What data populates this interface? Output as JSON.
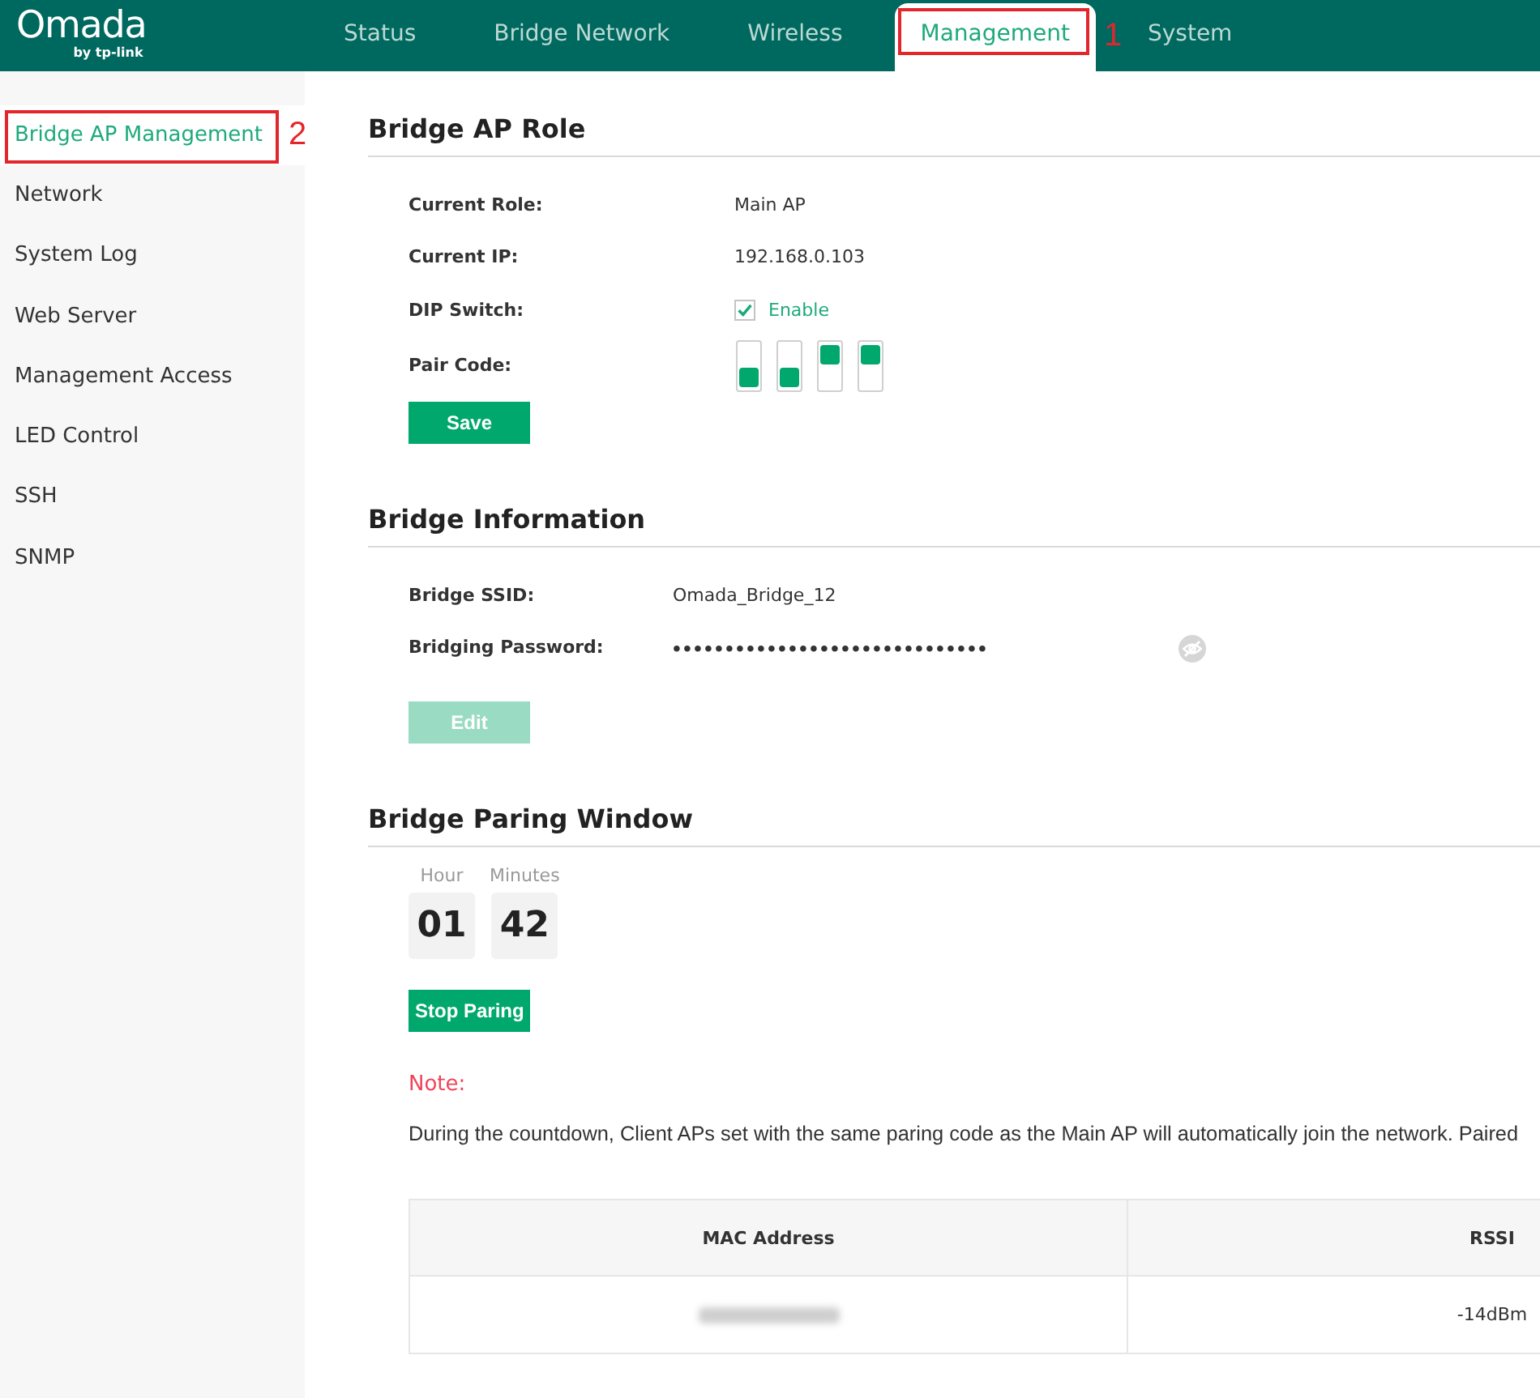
{
  "header": {
    "logo": {
      "wordmark": "Omada",
      "tagline": "by tp-link"
    },
    "tabs": [
      {
        "label": "Status",
        "selected": false
      },
      {
        "label": "Bridge Network",
        "selected": false
      },
      {
        "label": "Wireless",
        "selected": false
      },
      {
        "label": "Management",
        "selected": true,
        "callout": "1"
      },
      {
        "label": "System",
        "selected": false
      }
    ]
  },
  "sidebar": {
    "items": [
      {
        "label": "Bridge AP Management",
        "selected": true,
        "callout": "2"
      },
      {
        "label": "Network",
        "selected": false
      },
      {
        "label": "System Log",
        "selected": false
      },
      {
        "label": "Web Server",
        "selected": false
      },
      {
        "label": "Management Access",
        "selected": false
      },
      {
        "label": "LED Control",
        "selected": false
      },
      {
        "label": "SSH",
        "selected": false
      },
      {
        "label": "SNMP",
        "selected": false
      }
    ]
  },
  "sections": [
    {
      "kind": "role",
      "title": "Bridge AP Role",
      "fields": [
        {
          "kind": "text",
          "label": "Current Role:",
          "value": "Main AP"
        },
        {
          "kind": "text",
          "label": "Current IP:",
          "value": "192.168.0.103"
        },
        {
          "kind": "checkbox",
          "label": "DIP Switch:",
          "checked": true,
          "option": "Enable"
        },
        {
          "kind": "dip",
          "label": "Pair Code:",
          "switches": [
            {
              "on": false
            },
            {
              "on": false
            },
            {
              "on": true
            },
            {
              "on": true
            }
          ]
        }
      ],
      "button": {
        "label": "Save",
        "disabled": false
      }
    },
    {
      "kind": "info",
      "title": "Bridge Information",
      "fields": [
        {
          "kind": "text",
          "label": "Bridge SSID:",
          "value": "Omada_Bridge_12"
        },
        {
          "kind": "password",
          "label": "Bridging Password:",
          "value": "••••••••••••••••••••••••••••••"
        }
      ],
      "button": {
        "label": "Edit",
        "disabled": true
      }
    },
    {
      "kind": "pairing",
      "title": "Bridge Paring Window",
      "countdown": [
        {
          "label": "Hour",
          "value": "01"
        },
        {
          "label": "Minutes",
          "value": "42"
        }
      ],
      "button": {
        "label": "Stop Paring",
        "disabled": false
      },
      "note": {
        "title": "Note:",
        "text": "During the countdown, Client APs set with the same paring code as the Main AP will automatically join the network. Paired"
      },
      "table": {
        "columns": [
          "MAC Address",
          "RSSI"
        ],
        "rows": [
          {
            "mac_redacted": true,
            "rssi": "-14dBm"
          }
        ]
      }
    }
  ]
}
